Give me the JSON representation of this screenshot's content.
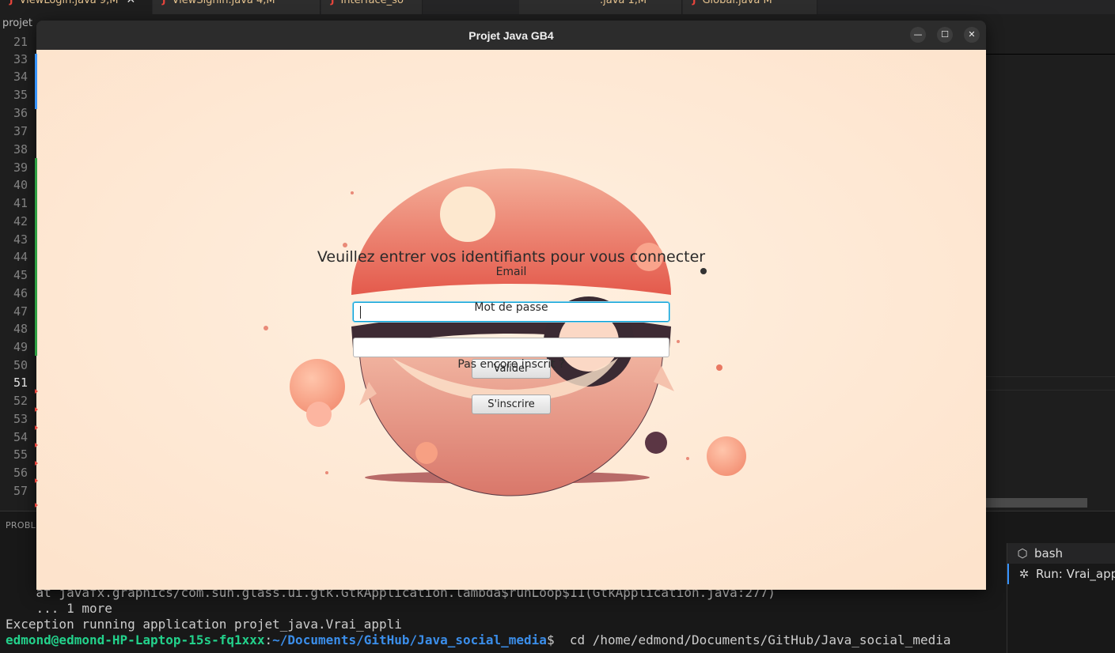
{
  "editor": {
    "tabs": [
      {
        "label": "ViewLogin.java 9,M"
      },
      {
        "label": "ViewSignin.java 4,M"
      },
      {
        "label": "Interface_so"
      },
      {
        "label": ".java 1,M"
      },
      {
        "label": "Global.java M"
      }
    ],
    "tab_close_glyph": "✕",
    "java_glyph": "J",
    "breadcrumb": "projet",
    "line_numbers": [
      "21",
      "33",
      "34",
      "35",
      "36",
      "37",
      "38",
      "39",
      "40",
      "41",
      "42",
      "43",
      "44",
      "45",
      "46",
      "47",
      "48",
      "49",
      "50",
      "51",
      "52",
      "53",
      "54",
      "55",
      "56",
      "57"
    ],
    "current_line": "51"
  },
  "panel": {
    "tab_label": "PROBL",
    "terminal_lines": [
      "    at javafx.graphics/com.sun.glass.ui.gtk.GtkApplication.lambda$runLoop$11(GtkApplication.java:277)",
      "    ... 1 more",
      "Exception running application projet_java.Vrai_appli"
    ],
    "prompt_user": "edmond@edmond-HP-Laptop-15s-fq1xxx",
    "prompt_sep": ":",
    "prompt_path": "~/Documents/GitHub/Java_social_media",
    "prompt_cmd": "$  cd /home/edmond/Documents/GitHub/Java_social_media",
    "terminals": [
      {
        "label": "bash",
        "icon": "terminal-icon"
      },
      {
        "label": "Run: Vrai_appli",
        "icon": "debug-icon"
      }
    ]
  },
  "window": {
    "title": "Projet Java GB4",
    "minimize_glyph": "—",
    "maximize_glyph": "☐",
    "close_glyph": "✕"
  },
  "login": {
    "heading": "Veuillez entrer vos identifiants pour vous connecter",
    "email_label": "Email",
    "email_value": "",
    "password_label": "Mot de passe",
    "password_value": "",
    "submit_label": "Valider",
    "signup_prompt": "Pas encore inscrit ?",
    "signup_label": "S'inscrire"
  },
  "colors": {
    "window_background": "#fde8d4",
    "ball_red": "#e8735f",
    "focus_border": "#039ed3",
    "terminal_green": "#23d18b",
    "terminal_blue": "#3b8eea"
  }
}
